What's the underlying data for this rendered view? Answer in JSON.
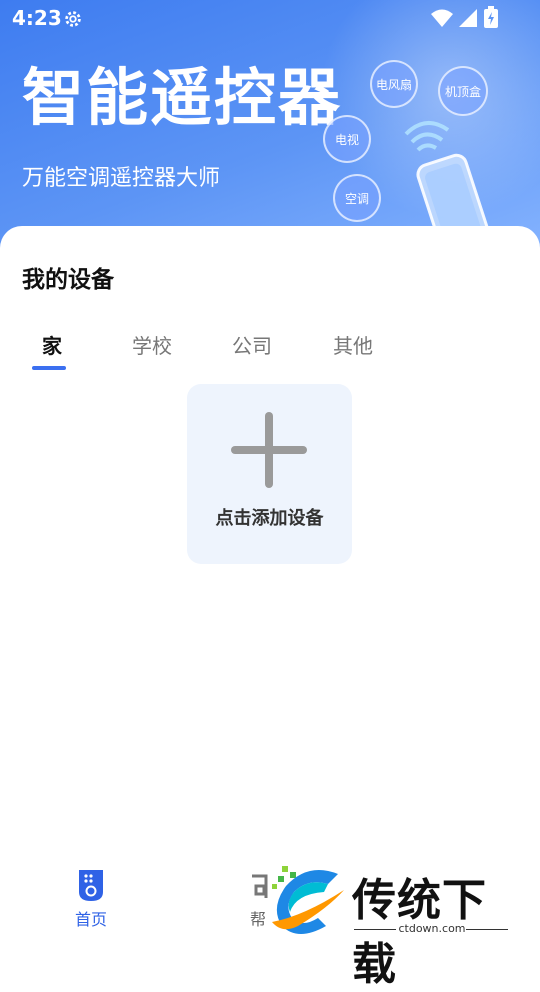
{
  "status_bar": {
    "time": "4:23"
  },
  "hero": {
    "title": "智能遥控器",
    "subtitle": "万能空调遥控器大师",
    "bubbles": [
      "电风扇",
      "机顶盒",
      "电视",
      "空调"
    ]
  },
  "devices": {
    "heading": "我的设备",
    "tabs": [
      "家",
      "学校",
      "公司",
      "其他"
    ],
    "active_tab": "家",
    "add_label": "点击添加设备"
  },
  "bottom_nav": {
    "home_label": "首页",
    "second_label_partial": "帮"
  },
  "watermark": {
    "brand": "传统下载",
    "url": "ctdown.com"
  },
  "colors": {
    "accent": "#3b6ff0",
    "hero_start": "#3e7cf0",
    "hero_end": "#86b4ff",
    "add_card_bg": "#eef4fd"
  }
}
